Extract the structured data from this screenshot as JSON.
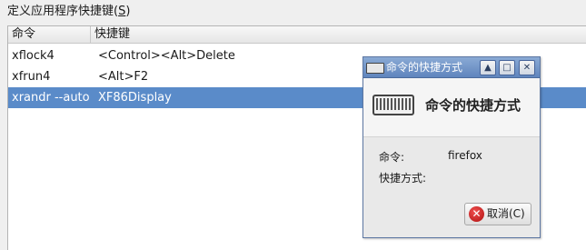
{
  "section_label": "定义应用程序快捷键(",
  "section_label_accel": "S",
  "section_label_end": ")",
  "table": {
    "headers": [
      "命令",
      "快捷键"
    ],
    "rows": [
      {
        "command": "xflock4",
        "shortcut": "<Control><Alt>Delete"
      },
      {
        "command": "xfrun4",
        "shortcut": "<Alt>F2"
      },
      {
        "command": "xrandr --auto",
        "shortcut": "XF86Display"
      }
    ],
    "selected_row": 2
  },
  "dialog": {
    "window_title": "命令的快捷方式",
    "header_title": "命令的快捷方式",
    "command_label": "命令:",
    "command_value": "firefox",
    "shortcut_label": "快捷方式:",
    "shortcut_value": "",
    "cancel_label": "取消(C)",
    "icons": {
      "window": "keyboard-icon",
      "header": "keyboard-icon",
      "cancel": "cancel-icon"
    }
  },
  "colors": {
    "selection": "#5a8bc9",
    "titlebar": "#6f93c8"
  }
}
